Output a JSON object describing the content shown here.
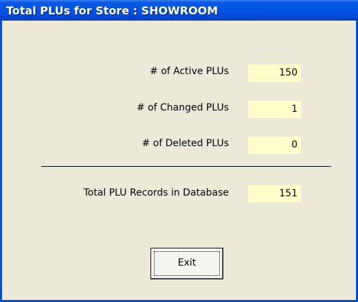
{
  "window": {
    "title": "Total PLUs for Store :  SHOWROOM"
  },
  "stats": [
    {
      "label": "# of Active PLUs",
      "value": "150"
    },
    {
      "label": "# of Changed PLUs",
      "value": "1"
    },
    {
      "label": "# of Deleted PLUs",
      "value": "0"
    }
  ],
  "total": {
    "label": "Total PLU Records in Database",
    "value": "151"
  },
  "buttons": {
    "exit_label": "Exit"
  },
  "colors": {
    "title_bar": "#0054e3",
    "value_bg": "#ffffcc",
    "window_bg": "#ece9d8"
  }
}
